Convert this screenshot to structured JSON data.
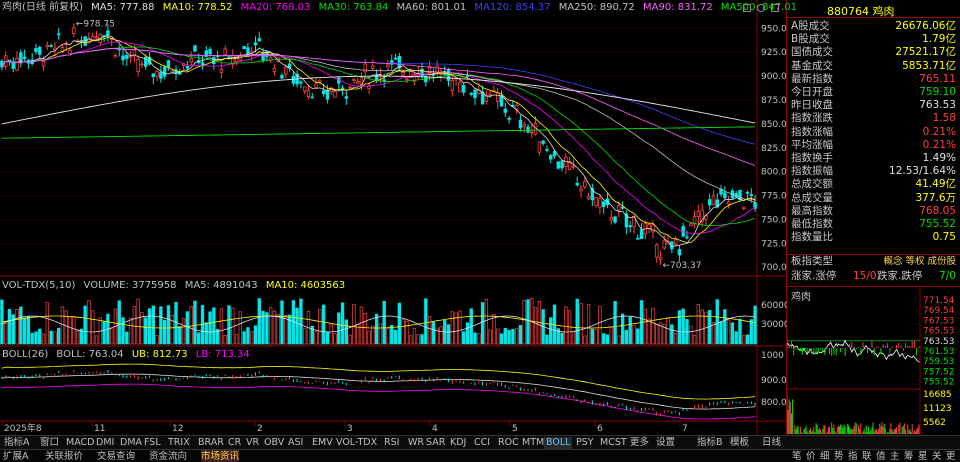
{
  "main_legend": {
    "title": "鸡肉(日线 前复权)",
    "items": [
      {
        "label": "MA5: 777.88",
        "color": "#e0e0e0"
      },
      {
        "label": "MA10: 778.52",
        "color": "#ffff00"
      },
      {
        "label": "MA20: 768.03",
        "color": "#ff00ff"
      },
      {
        "label": "MA30: 763.84",
        "color": "#00e000"
      },
      {
        "label": "MA60: 801.01",
        "color": "#c0c0c0"
      },
      {
        "label": "MA120: 854.37",
        "color": "#4040ff"
      },
      {
        "label": "MA250: 890.72",
        "color": "#c0c0c0"
      },
      {
        "label": "MA90: 831.72",
        "color": "#ff60ff"
      },
      {
        "label": "MA500: 847.01",
        "color": "#00e000"
      }
    ],
    "high_mark": "978.75",
    "low_mark": "703.37"
  },
  "price_axis": [
    "950.00",
    "925.00",
    "900.00",
    "875.00",
    "850.00",
    "825.00",
    "800.00",
    "775.00",
    "750.00",
    "725.00",
    "700.00"
  ],
  "vol_legend": {
    "items": [
      {
        "label": "VOL-TDX(5,10)",
        "color": "#c0c0c0"
      },
      {
        "label": "VOLUME: 3775958",
        "color": "#c0c0c0"
      },
      {
        "label": "MA5: 4891043",
        "color": "#c0c0c0"
      },
      {
        "label": "MA10: 4603563",
        "color": "#ffff00"
      }
    ]
  },
  "vol_axis": [
    "60000",
    "30000"
  ],
  "boll_legend": {
    "items": [
      {
        "label": "BOLL(26)",
        "color": "#c0c0c0"
      },
      {
        "label": "BOLL: 763.04",
        "color": "#c0c0c0"
      },
      {
        "label": "UB: 812.73",
        "color": "#ffff00"
      },
      {
        "label": "LB: 713.34",
        "color": "#ff00ff"
      }
    ]
  },
  "boll_axis": [
    "1000",
    "900.00",
    "800.00"
  ],
  "date_axis": [
    "2025年8",
    "11",
    "12",
    "2",
    "3",
    "4",
    "5",
    "6",
    "7"
  ],
  "side": {
    "code": "880764",
    "name": "鸡肉",
    "rows": [
      {
        "label": "A股成交",
        "value": "26676.06亿",
        "color": "#ffff00"
      },
      {
        "label": "B股成交",
        "value": "1.79亿",
        "color": "#ffff00"
      },
      {
        "label": "国债成交",
        "value": "27521.17亿",
        "color": "#ffff00"
      },
      {
        "label": "基金成交",
        "value": "5853.71亿",
        "color": "#ffff00"
      },
      {
        "label": "最新指数",
        "value": "765.11",
        "color": "#ff4040"
      },
      {
        "label": "今日开盘",
        "value": "759.10",
        "color": "#00e000"
      },
      {
        "label": "昨日收盘",
        "value": "763.53",
        "color": "#e0e0e0"
      },
      {
        "label": "指数涨跌",
        "value": "1.58",
        "color": "#ff4040"
      },
      {
        "label": "指数涨幅",
        "value": "0.21%",
        "color": "#ff4040"
      },
      {
        "label": "平均涨幅",
        "value": "0.21%",
        "color": "#ff4040"
      },
      {
        "label": "指数换手",
        "value": "1.49%",
        "color": "#e0e0e0"
      },
      {
        "label": "指数振幅",
        "value": "12.53/1.64%",
        "color": "#e0e0e0"
      },
      {
        "label": "总成交额",
        "value": "41.49亿",
        "color": "#ffff00"
      },
      {
        "label": "总成交量",
        "value": "377.6万",
        "color": "#ffff00"
      },
      {
        "label": "最高指数",
        "value": "768.05",
        "color": "#ff4040"
      },
      {
        "label": "最低指数",
        "value": "755.52",
        "color": "#00e000"
      },
      {
        "label": "指数量比",
        "value": "0.75",
        "color": "#ffff00"
      }
    ],
    "board_type_label": "板指类型",
    "board_type_value": "概念 等权 成份股",
    "up_label": "涨家.涨停",
    "up_value": "15/0",
    "down_label": "跌家.跌停",
    "down_value": "7/0",
    "mini_title": "鸡肉",
    "mini_price_axis": [
      "771.54",
      "769.54",
      "767.53",
      "765.53",
      "763.53",
      "761.53",
      "759.53",
      "757.52",
      "755.52"
    ],
    "mini_vol_axis": [
      "16685",
      "11123",
      "5562"
    ],
    "mini_bar_labels": [
      "1000",
      "1000"
    ]
  },
  "indicator_tabs": [
    "指标A",
    "窗口",
    "MACD",
    "DMI",
    "DMA",
    "FSL",
    "TRIX",
    "BRAR",
    "CR",
    "VR",
    "OBV",
    "ASI",
    "EMV",
    "VOL-TDX",
    "RSI",
    "WR",
    "SAR",
    "KDJ",
    "CCI",
    "ROC",
    "MTM",
    "BOLL",
    "PSY",
    "MCST",
    "更多",
    "设置"
  ],
  "active_tab": "BOLL",
  "right_tabs": [
    "指标B",
    "模板",
    "日线"
  ],
  "bottom_tabs": [
    "扩展A",
    "关联报价",
    "交易查询",
    "资金流向",
    "市场资讯"
  ],
  "bottom_right_tabs": [
    "笔",
    "价",
    "细",
    "势",
    "指",
    "联",
    "值",
    "主",
    "筹",
    "星",
    "关",
    "更"
  ],
  "colors": {
    "up": "#ff4040",
    "down": "#00e5e5",
    "bg": "#000000",
    "grid": "#8b0000"
  }
}
